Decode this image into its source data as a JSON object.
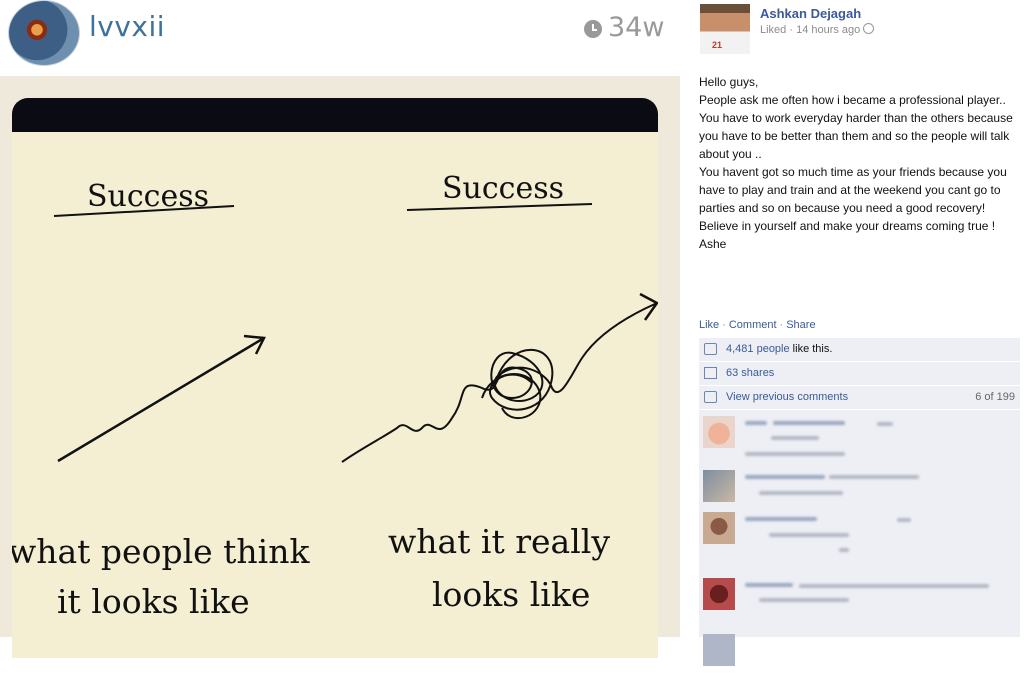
{
  "instagram": {
    "username": "lvvxii",
    "time_ago": "34w",
    "image": {
      "left_heading": "Success",
      "right_heading": "Success",
      "left_caption_line1": "what people think",
      "left_caption_line2": "it looks like",
      "right_caption_line1": "what it really",
      "right_caption_line2": "looks like"
    }
  },
  "facebook": {
    "author": "Ashkan Dejagah",
    "meta": "Liked · 14 hours ago",
    "jersey_number": "21",
    "post_lines": [
      "Hello guys,",
      "People ask me often how i became a professional player..",
      "You have to work everyday harder than the others because you have to be better than them and so the people will talk about you ..",
      "You havent got so much time as your friends because you have to play and train and at the weekend you cant go to parties and so on because you need a good recovery!",
      "Believe in yourself and make your dreams coming true !",
      "Ashe"
    ],
    "actions": {
      "like": "Like",
      "comment": "Comment",
      "share": "Share"
    },
    "likes": {
      "count": "4,481 people",
      "suffix": " like this."
    },
    "shares": "63 shares",
    "view_previous": "View previous comments",
    "comments_count": "6 of 199"
  },
  "colors": {
    "instagram_blue": "#3f729b",
    "facebook_blue": "#3b5998",
    "ufi_background": "#edeff4"
  },
  "icons": [
    "clock-icon",
    "globe-icon",
    "thumb-icon",
    "share-icon",
    "comment-icon"
  ]
}
